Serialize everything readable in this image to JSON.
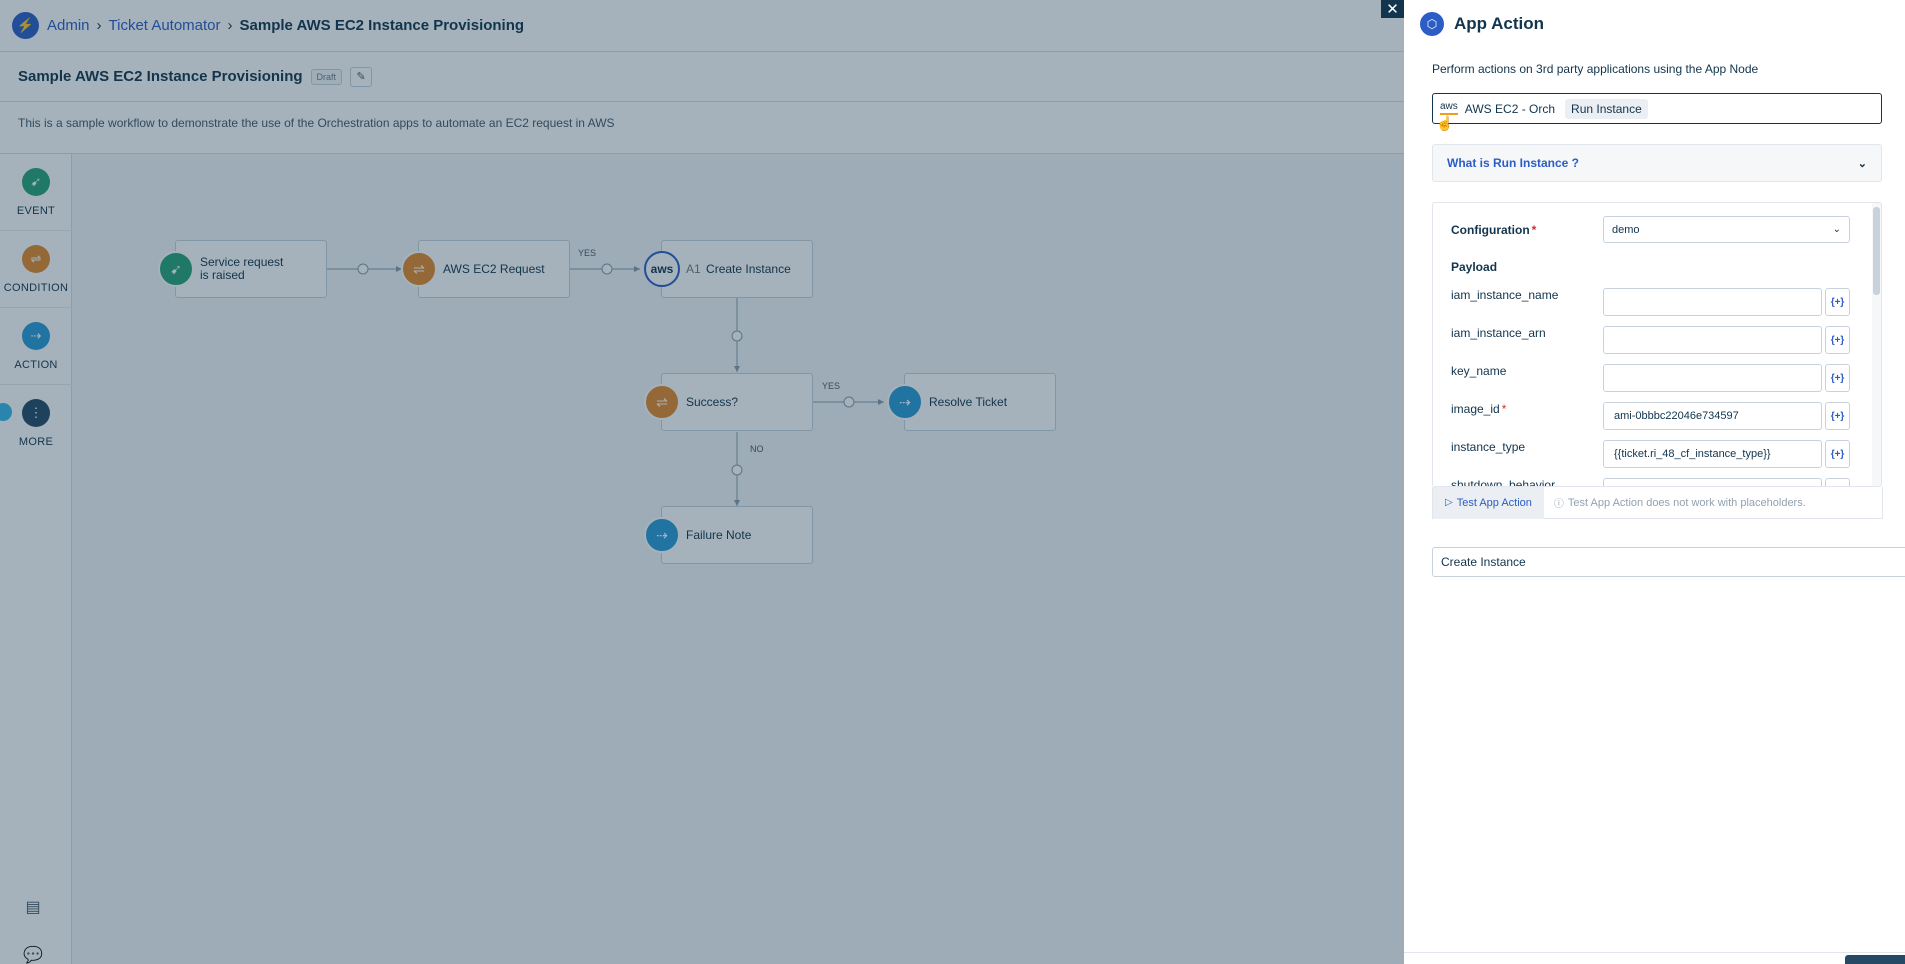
{
  "breadcrumb": [
    "Admin",
    "Ticket Automator",
    "Sample AWS EC2 Instance Provisioning"
  ],
  "workflow": {
    "title": "Sample AWS EC2 Instance Provisioning",
    "status_badge": "Draft",
    "description": "This is a sample workflow to demonstrate the use of the Orchestration apps to automate an EC2 request in AWS"
  },
  "rail": {
    "items": [
      {
        "label": "EVENT",
        "icon": "event-icon",
        "color": "#27a376"
      },
      {
        "label": "CONDITION",
        "icon": "condition-icon",
        "color": "#e58a2b"
      },
      {
        "label": "ACTION",
        "icon": "action-icon",
        "color": "#2a9bd6"
      },
      {
        "label": "MORE",
        "icon": "more-icon",
        "color": "#264966"
      }
    ]
  },
  "nodes": {
    "event": {
      "label": "Service request is raised",
      "icon": "event-icon",
      "color": "#27a376"
    },
    "aws_request": {
      "label": "AWS EC2 Request",
      "icon": "condition-icon",
      "color": "#e58a2b"
    },
    "create_instance": {
      "prefix": "A1",
      "label": "Create Instance",
      "icon": "aws-logo"
    },
    "success": {
      "label": "Success?",
      "icon": "condition-icon",
      "color": "#e58a2b"
    },
    "resolve": {
      "label": "Resolve Ticket",
      "icon": "action-icon",
      "color": "#2a9bd6"
    },
    "failure": {
      "label": "Failure Note",
      "icon": "action-icon",
      "color": "#2a9bd6"
    }
  },
  "edges": {
    "yes1": "YES",
    "yes2": "YES",
    "no": "NO"
  },
  "panel": {
    "title": "App Action",
    "subtitle": "Perform actions on 3rd party applications using the App Node",
    "app_logo_text": "aws",
    "app_name": "AWS EC2 - Orch",
    "action_chip": "Run Instance",
    "whatis_label": "What is Run Instance ?",
    "configuration": {
      "label": "Configuration",
      "value": "demo"
    },
    "payload_label": "Payload",
    "fields": [
      {
        "label": "iam_instance_name",
        "value": "",
        "required": false
      },
      {
        "label": "iam_instance_arn",
        "value": "",
        "required": false
      },
      {
        "label": "key_name",
        "value": "",
        "required": false
      },
      {
        "label": "image_id",
        "value": "ami-0bbbc22046e734597",
        "required": true
      },
      {
        "label": "instance_type",
        "value": "{{ticket.ri_48_cf_instance_type}}",
        "required": false
      },
      {
        "label": "shutdown_behavior",
        "value": "",
        "required": false
      }
    ],
    "placeholder_btn": "{+}",
    "test_button": "Test App Action",
    "test_note": "Test App Action does not work with placeholders.",
    "node_name": "Create Instance"
  },
  "colors": {
    "brand": "#2c5cc5",
    "text": "#12344d",
    "overlay": "rgba(18,52,77,0.38)"
  }
}
